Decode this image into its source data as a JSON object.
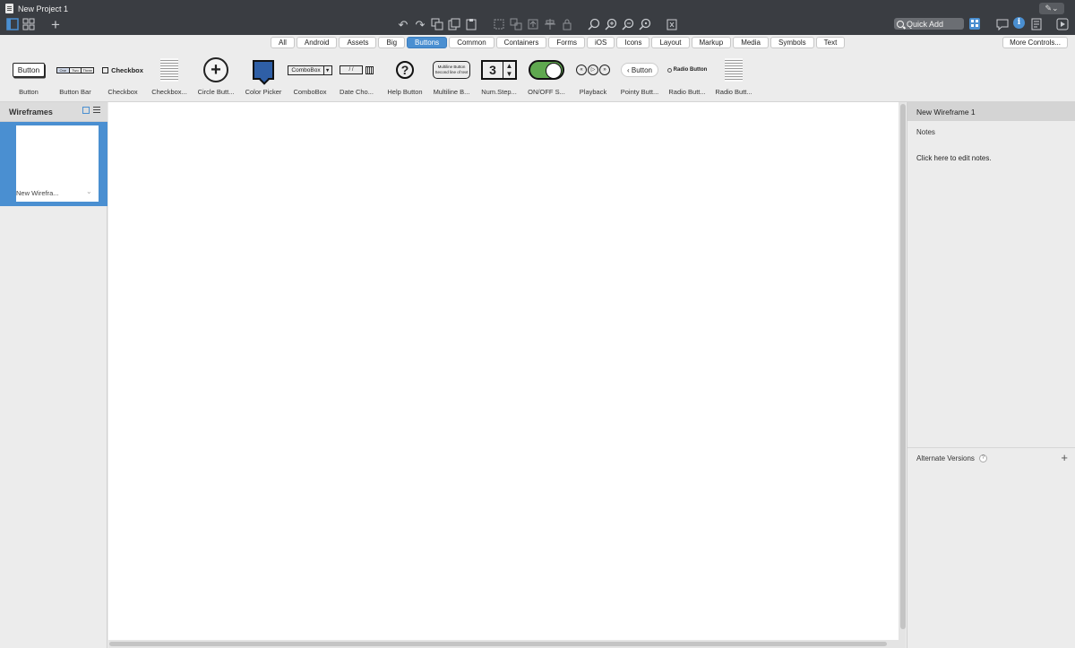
{
  "window": {
    "title": "New Project 1"
  },
  "toolbar": {
    "quick_add_label": "Quick Add"
  },
  "library_tabs": {
    "items": [
      "All",
      "Android",
      "Assets",
      "Big",
      "Buttons",
      "Common",
      "Containers",
      "Forms",
      "iOS",
      "Icons",
      "Layout",
      "Markup",
      "Media",
      "Symbols",
      "Text"
    ],
    "active": "Buttons",
    "more_label": "More Controls..."
  },
  "controls": {
    "items": [
      {
        "label": "Button",
        "preview_text": "Button"
      },
      {
        "label": "Button Bar",
        "preview_segments": [
          "One",
          "Two",
          "Three"
        ]
      },
      {
        "label": "Checkbox",
        "preview_text": "Checkbox"
      },
      {
        "label": "Checkbox..."
      },
      {
        "label": "Circle Butt..."
      },
      {
        "label": "Color Picker"
      },
      {
        "label": "ComboBox",
        "preview_text": "ComboBox"
      },
      {
        "label": "Date Cho...",
        "preview_text": "/ /"
      },
      {
        "label": "Help Button"
      },
      {
        "label": "Multiline B...",
        "preview_lines": [
          "Multiline Button",
          "Second line of text"
        ]
      },
      {
        "label": "Num.Step...",
        "preview_text": "3"
      },
      {
        "label": "ON/OFF S..."
      },
      {
        "label": "Playback"
      },
      {
        "label": "Pointy Butt...",
        "preview_text": "Button"
      },
      {
        "label": "Radio Butt...",
        "preview_text": "Radio Button"
      },
      {
        "label": "Radio Butt..."
      }
    ]
  },
  "left_panel": {
    "title": "Wireframes",
    "items": [
      {
        "label": "New Wirefra..."
      }
    ]
  },
  "right_panel": {
    "title": "New Wireframe 1",
    "notes_label": "Notes",
    "notes_placeholder": "Click here to edit notes.",
    "alternate_versions_label": "Alternate Versions"
  },
  "colors": {
    "accent": "#4a8fd1",
    "titlebar": "#3a3d42",
    "toggle_on": "#5fa84f",
    "color_picker_swatch": "#2f5fa6"
  }
}
